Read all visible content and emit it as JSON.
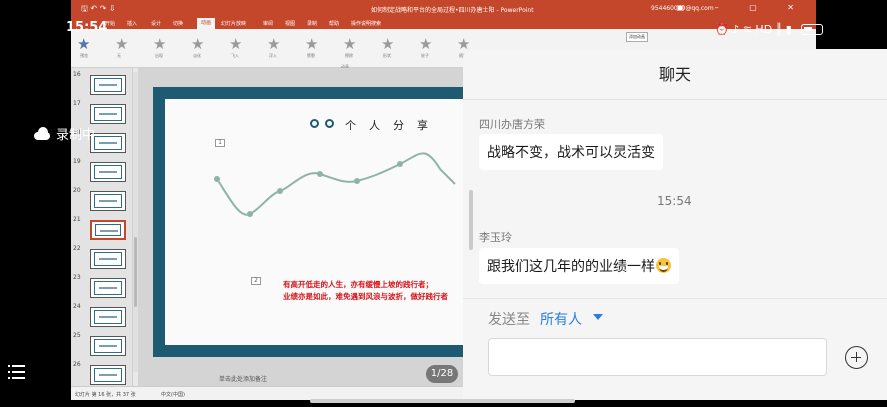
{
  "phone": {
    "time": "15:54",
    "record_label": "录制中",
    "status_icons": [
      "alarm-icon",
      "bell-off-icon",
      "wifi-icon",
      "hd-icon",
      "signal-icon",
      "battery-icon"
    ],
    "status_text": "⏰ ♪ ≋ HD ║ ▮"
  },
  "ppt": {
    "doc_title": "如何制定战略和平台的全局过程•四川办唐士阳 - PowerPoint",
    "account": "954460040@qq.com",
    "tabs": [
      "开始",
      "插入",
      "设计",
      "切换",
      "动画",
      "幻灯片放映",
      "审阅",
      "视图",
      "录制",
      "帮助",
      "操作说明搜索"
    ],
    "active_tab": "动画",
    "ribbon_group": "动画",
    "ribbon_right": "添加动画",
    "ribbon_star_labels": [
      "无",
      "出现",
      "淡化",
      "飞入",
      "浮入",
      "劈裂",
      "擦除",
      "形状",
      "轮子",
      "随机"
    ],
    "preview_label": "预览",
    "slide_numbers": [
      "16",
      "17",
      "18",
      "19",
      "20",
      "21",
      "22",
      "23",
      "24",
      "25",
      "26"
    ],
    "slide_title": "个人分享",
    "slide_box1": "1",
    "slide_box2": "2",
    "slide_line1": "有高开低走的人生，亦有缓慢上坡的践行者；",
    "slide_line2": "业绩亦是如此，难免遇到风浪与波折，做好践行者",
    "page_indicator": "1/28",
    "notes_placeholder": "单击此处添加备注",
    "status_slide": "幻灯片 第 16 张，共 37 张",
    "status_lang": "中文(中国)"
  },
  "chat": {
    "title": "聊天",
    "messages": [
      {
        "sender": "四川办唐方荣",
        "text": "战略不变，战术可以灵活变"
      },
      {
        "sender": "李玉玲",
        "text": "跟我们这几年的的业绩一样"
      }
    ],
    "time": "15:54",
    "send_to_label": "发送至",
    "send_target": "所有人",
    "input_placeholder": ""
  }
}
